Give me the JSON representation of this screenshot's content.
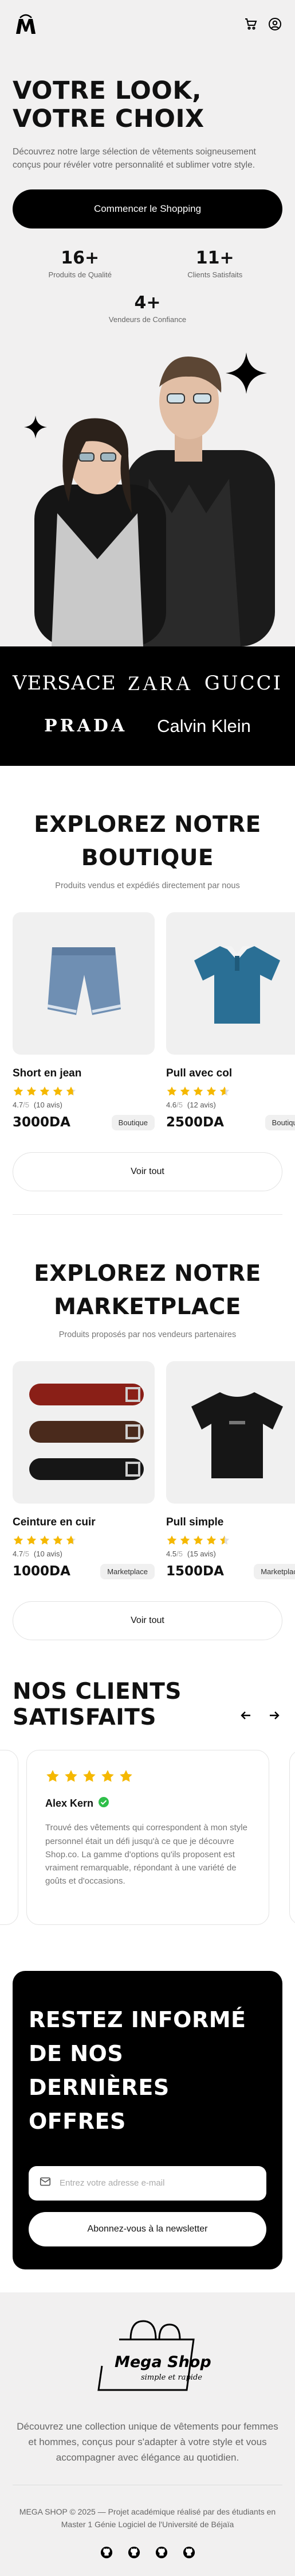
{
  "hero": {
    "title_line1": "VOTRE LOOK,",
    "title_line2": "VOTRE CHOIX",
    "lead": "Découvrez notre large sélection de vêtements soigneusement conçus pour révéler votre personnalité et sublimer votre style.",
    "cta": "Commencer le Shopping",
    "stats": [
      {
        "num": "16+",
        "label": "Produits de Qualité"
      },
      {
        "num": "11+",
        "label": "Clients Satisfaits"
      },
      {
        "num": "4+",
        "label": "Vendeurs de Confiance"
      }
    ]
  },
  "brands": [
    "VERSACE",
    "ZARA",
    "GUCCI",
    "PRADA",
    "Calvin Klein"
  ],
  "boutique": {
    "title_line1": "EXPLOREZ NOTRE",
    "title_line2": "BOUTIQUE",
    "subtitle": "Produits vendus et expédiés directement par nous",
    "products": [
      {
        "name": "Short en jean",
        "rating": "4.7",
        "out_of": "/5",
        "reviews": "(10 avis)",
        "stars": 4.7,
        "price": "3000DA",
        "tag": "Boutique"
      },
      {
        "name": "Pull avec col",
        "rating": "4.6",
        "out_of": "/5",
        "reviews": "(12 avis)",
        "stars": 4.6,
        "price": "2500DA",
        "tag": "Boutique"
      }
    ],
    "see_all": "Voir tout"
  },
  "marketplace": {
    "title_line1": "EXPLOREZ NOTRE",
    "title_line2": "MARKETPLACE",
    "subtitle": "Produits proposés par nos vendeurs partenaires",
    "products": [
      {
        "name": "Ceinture en cuir",
        "rating": "4.7",
        "out_of": "/5",
        "reviews": "(10 avis)",
        "stars": 4.7,
        "price": "1000DA",
        "tag": "Marketplace"
      },
      {
        "name": "Pull simple",
        "rating": "4.5",
        "out_of": "/5",
        "reviews": "(15 avis)",
        "stars": 4.5,
        "price": "1500DA",
        "tag": "Marketplace"
      }
    ],
    "see_all": "Voir tout"
  },
  "testimonials": {
    "title_line1": "NOS CLIENTS",
    "title_line2": "SATISFAITS",
    "items": [
      {
        "name": "Alex Kern",
        "text": "Trouvé des vêtements qui correspondent à mon style personnel était un défi jusqu'à ce que je découvre Shop.co. La gamme d'options qu'ils proposent est vraiment remarquable, répondant à une variété de goûts et d'occasions."
      }
    ]
  },
  "newsletter": {
    "title_line1": "RESTEZ INFORMÉ",
    "title_line2": "DE NOS DERNIÈRES",
    "title_line3": "OFFRES",
    "placeholder": "Entrez votre adresse e-mail",
    "button": "Abonnez-vous à la newsletter"
  },
  "footer": {
    "logo_text": "Mega Shop",
    "logo_tagline": "simple et rapide",
    "description": "Découvrez une collection unique de vêtements pour femmes et hommes, conçus pour s'adapter à votre style et vous accompagner avec élégance au quotidien.",
    "copyright": "MEGA SHOP © 2025 — Projet académique réalisé par des étudiants en Master 1 Génie Logiciel de l'Université de Béjaïa"
  },
  "colors": {
    "star": "#f5b800",
    "verified": "#2fbf4a",
    "dark": "#000000",
    "light_bg": "#f1f0f0"
  }
}
